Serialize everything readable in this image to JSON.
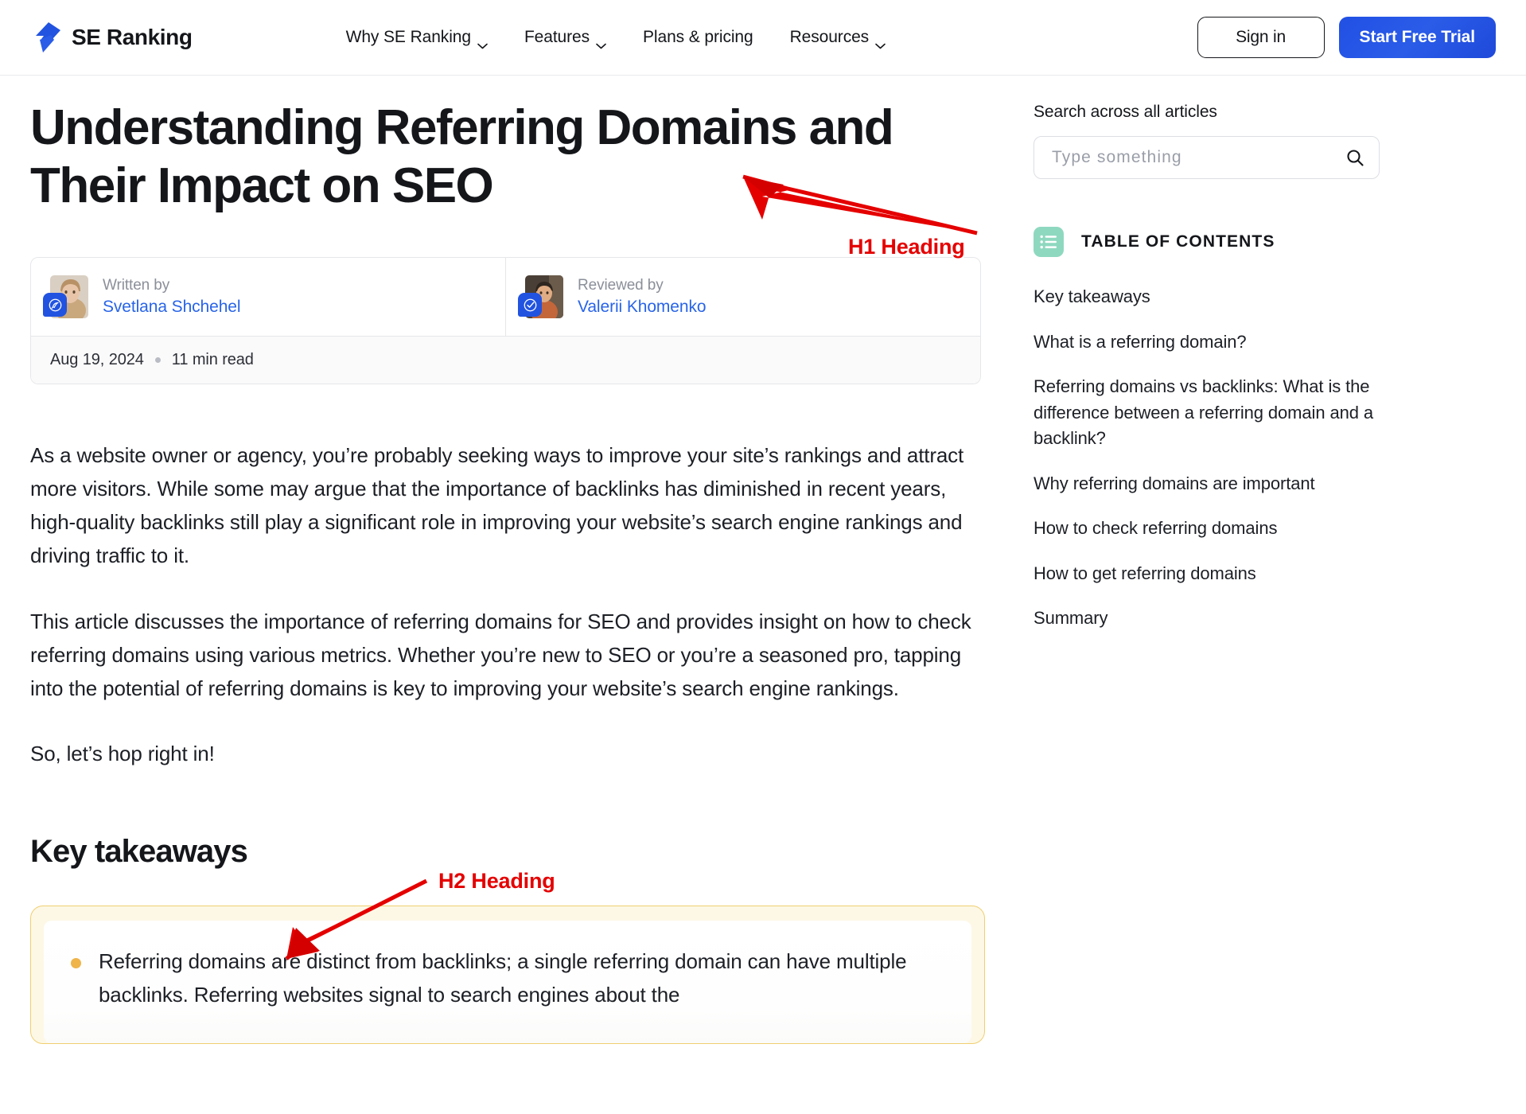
{
  "header": {
    "brand_name": "SE Ranking",
    "brand_logo_icon": "se-ranking-bolt-logo",
    "nav": [
      {
        "label": "Why SE Ranking",
        "has_dropdown": true
      },
      {
        "label": "Features",
        "has_dropdown": true
      },
      {
        "label": "Plans & pricing",
        "has_dropdown": false
      },
      {
        "label": "Resources",
        "has_dropdown": true
      }
    ],
    "sign_in_label": "Sign in",
    "start_trial_label": "Start Free Trial",
    "accent_color": "#2253e0"
  },
  "article": {
    "title": "Understanding Referring Domains and Their Impact on SEO",
    "byline": {
      "written_by_label": "Written by",
      "written_by_name": "Svetlana Shchehel",
      "written_by_badge_icon": "quill-pen-icon",
      "reviewed_by_label": "Reviewed by",
      "reviewed_by_name": "Valerii Khomenko",
      "reviewed_by_badge_icon": "check-circle-icon",
      "date": "Aug 19, 2024",
      "read_time": "11 min read"
    },
    "paragraphs": [
      "As a website owner or agency, you’re probably seeking ways to improve your site’s rankings and attract more visitors. While some may argue that the importance of backlinks has diminished in recent years, high-quality backlinks still play a significant role in improving your website’s search engine rankings and driving traffic to it.",
      "This article discusses the importance of referring domains for SEO and provides insight on how to check referring domains using various metrics. Whether you’re new to SEO or you’re a seasoned pro, tapping into the potential of referring domains is key to improving your website’s search engine rankings.",
      "So, let’s hop right in!"
    ],
    "section_heading": "Key takeaways",
    "callout": {
      "bullet_text": "Referring domains are distinct from backlinks; a single referring domain can have multiple backlinks. Referring websites signal to search engines about the",
      "border_color": "#f0cf72",
      "background_color": "#fdf8e6",
      "bullet_color": "#efb44a"
    }
  },
  "sidebar": {
    "search_label": "Search across all articles",
    "search_placeholder": "Type something",
    "search_value": "",
    "search_icon": "magnifier-icon",
    "toc_icon": "list-icon",
    "toc_icon_color": "#8fd8c0",
    "toc_title": "TABLE OF CONTENTS",
    "toc_items": [
      "Key takeaways",
      "What is a referring domain?",
      "Referring domains vs backlinks: What is the difference between a referring domain and a backlink?",
      "Why referring domains are important",
      "How to check referring domains",
      "How to get referring domains",
      "Summary"
    ]
  },
  "annotations": {
    "color": "#e50000",
    "h1_label": "H1 Heading",
    "h2_label": "H2 Heading"
  }
}
